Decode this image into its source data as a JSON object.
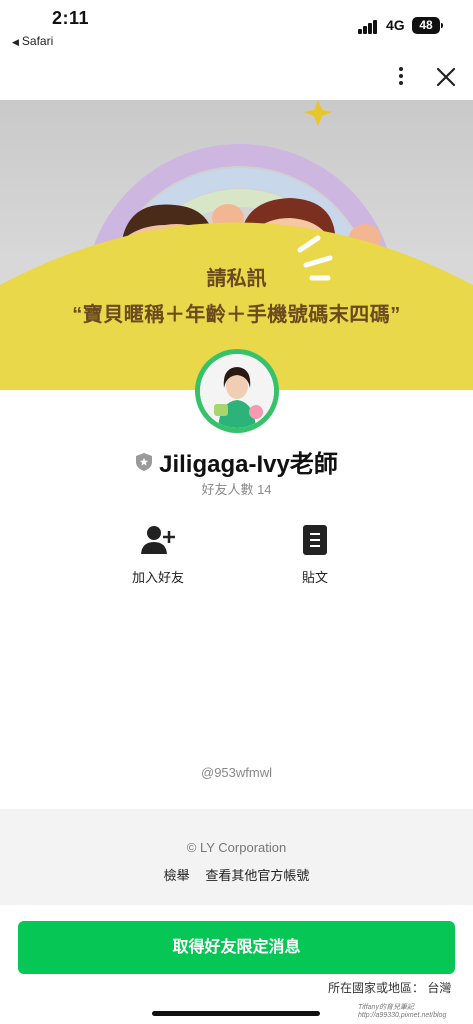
{
  "status_bar": {
    "time": "2:11",
    "back_app": "Safari",
    "network": "4G",
    "battery": "48"
  },
  "header": {
    "more_icon": "more-vertical-icon",
    "close_icon": "close-icon"
  },
  "banner": {
    "line1": "請私訊",
    "line2": "“寶貝暱稱＋年齡＋手機號碼末四碼”"
  },
  "profile": {
    "name": "Jiligaga-Ivy老師",
    "friend_count": "好友人數 14",
    "badge_icon": "shield-icon"
  },
  "actions": [
    {
      "label": "加入好友",
      "icon": "add-friend-icon"
    },
    {
      "label": "貼文",
      "icon": "post-document-icon"
    }
  ],
  "handle": "@953wfmwl",
  "footer": {
    "copyright": "© LY Corporation",
    "report": "檢舉",
    "other_accounts": "查看其他官方帳號"
  },
  "cta": {
    "label": "取得好友限定消息"
  },
  "region": "所在國家或地區： 台灣",
  "watermark": "Tiffany的育兒筆記 http://a99330.pixnet.net/blog",
  "colors": {
    "line_green": "#06c755",
    "banner_yellow": "#e8d84a",
    "banner_text": "#6b4a1e"
  }
}
